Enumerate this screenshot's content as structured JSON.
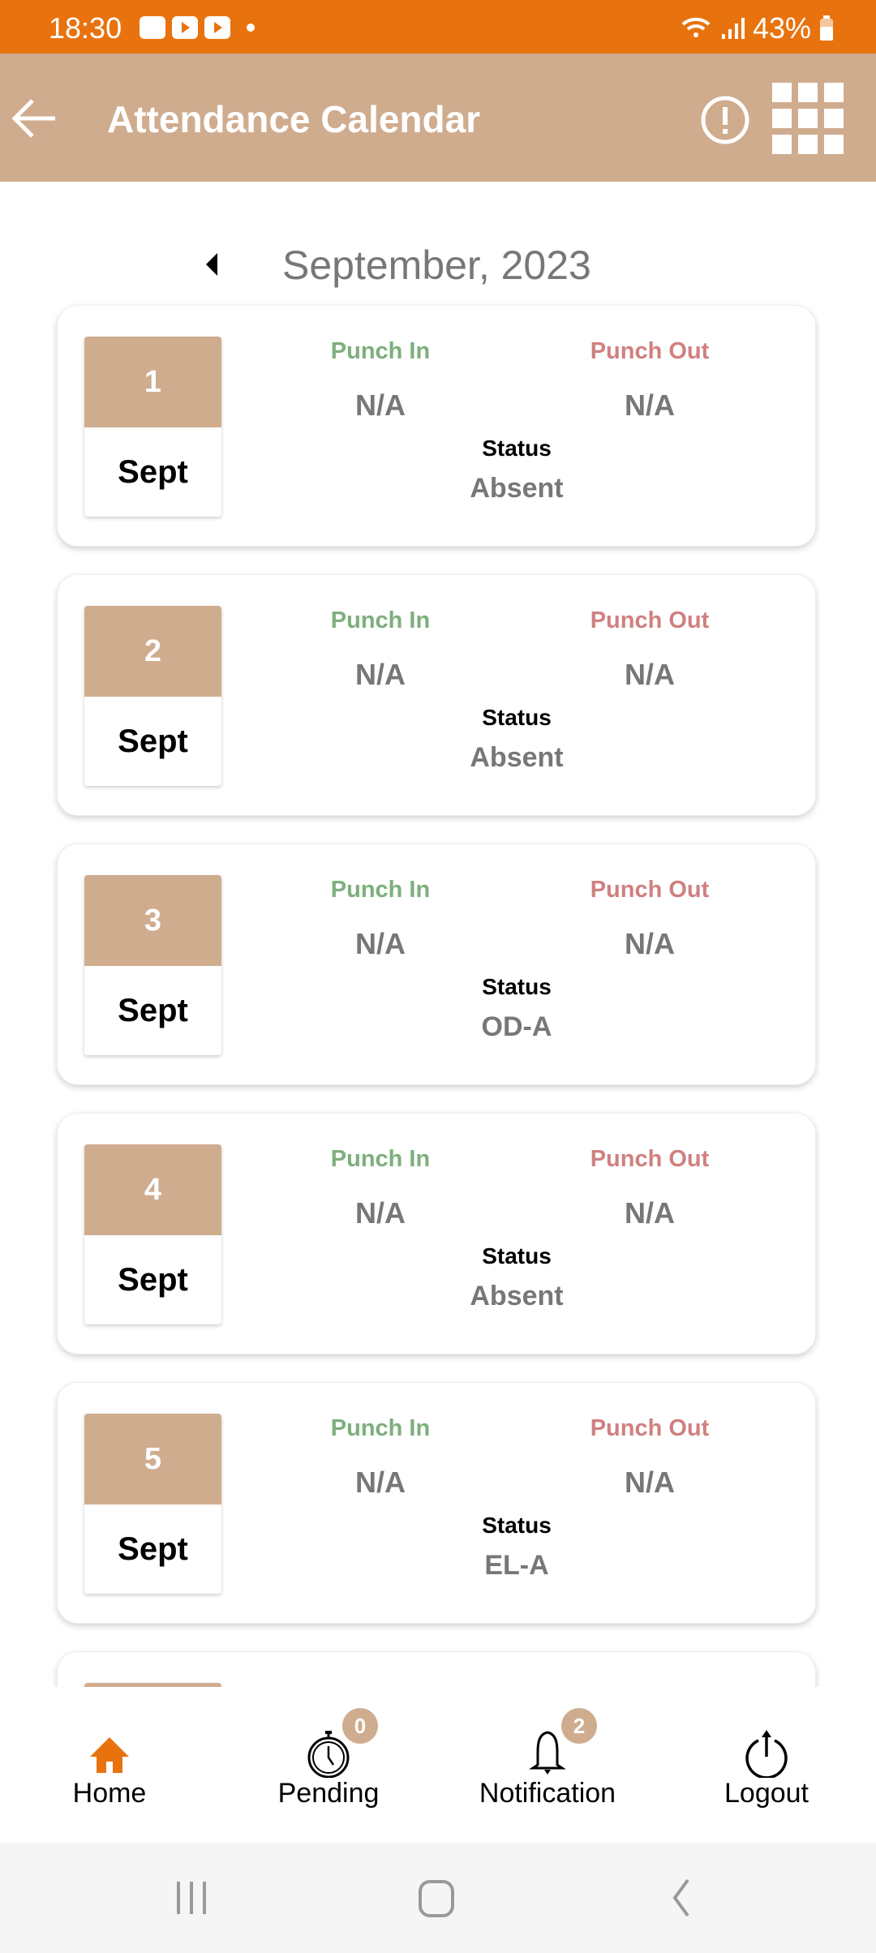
{
  "status_bar": {
    "time": "18:30",
    "battery": "43%"
  },
  "app_bar": {
    "title": "Attendance Calendar"
  },
  "calendar": {
    "month_label": "September, 2023"
  },
  "labels": {
    "punch_in": "Punch In",
    "punch_out": "Punch Out",
    "status": "Status"
  },
  "days": [
    {
      "day": "1",
      "month": "Sept",
      "punch_in": "N/A",
      "punch_out": "N/A",
      "status": "Absent"
    },
    {
      "day": "2",
      "month": "Sept",
      "punch_in": "N/A",
      "punch_out": "N/A",
      "status": "Absent"
    },
    {
      "day": "3",
      "month": "Sept",
      "punch_in": "N/A",
      "punch_out": "N/A",
      "status": "OD-A"
    },
    {
      "day": "4",
      "month": "Sept",
      "punch_in": "N/A",
      "punch_out": "N/A",
      "status": "Absent"
    },
    {
      "day": "5",
      "month": "Sept",
      "punch_in": "N/A",
      "punch_out": "N/A",
      "status": "EL-A"
    }
  ],
  "bottom_nav": {
    "items": [
      {
        "label": "Home",
        "icon": "home-icon",
        "active": true
      },
      {
        "label": "Pending",
        "icon": "stopwatch-icon",
        "badge": "0"
      },
      {
        "label": "Notification",
        "icon": "bell-icon",
        "badge": "2"
      },
      {
        "label": "Logout",
        "icon": "power-icon"
      }
    ]
  },
  "colors": {
    "status_bar": "#E8730E",
    "primary": "#D0AC8E",
    "punch_in": "#7DAF7D",
    "punch_out": "#D08080",
    "active_nav": "#E8730E"
  }
}
